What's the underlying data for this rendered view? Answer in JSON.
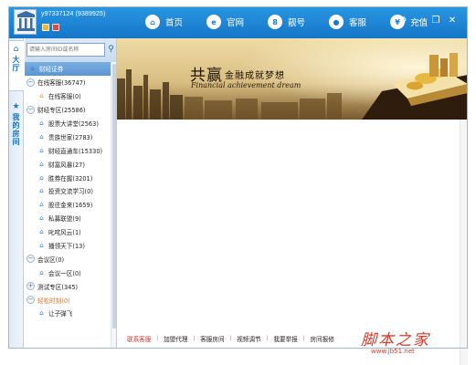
{
  "titlebar": {
    "user_id": "y97337124 (9389925)",
    "logo_icon": "building-logo",
    "accent_color": "#1b7bcc",
    "nav": [
      {
        "label": "首页",
        "icon": "home-icon",
        "glyph": "⌂"
      },
      {
        "label": "官网",
        "icon": "ie-icon",
        "glyph": "e"
      },
      {
        "label": "靓号",
        "icon": "number-icon",
        "glyph": "8"
      },
      {
        "label": "客服",
        "icon": "user-icon",
        "glyph": "●"
      },
      {
        "label": "充值",
        "icon": "yen-icon",
        "glyph": "¥"
      }
    ],
    "controls": {
      "settings": "⚙",
      "minimize": "–",
      "restore": "❐",
      "close": "✕"
    }
  },
  "vtabs": [
    {
      "label": "大厅",
      "icon": "home-icon",
      "glyph": "⌂"
    },
    {
      "label": "我的房间",
      "icon": "star-icon",
      "glyph": "★"
    }
  ],
  "search": {
    "placeholder": "请输入房间ID或名称",
    "button_glyph": "⚲"
  },
  "tree": [
    {
      "text": "财经证券",
      "level": "header",
      "glyph": "⌂"
    },
    {
      "text": "在线客服(36747)",
      "level": "group",
      "glyph": "−"
    },
    {
      "text": "在线客服(0)",
      "level": "item",
      "glyph": "⌂",
      "orange": true
    },
    {
      "text": "财经专区(25586)",
      "level": "group",
      "glyph": "−"
    },
    {
      "text": "股票大讲堂(2563)",
      "level": "item",
      "glyph": "⌂"
    },
    {
      "text": "贵族世家(2783)",
      "level": "item",
      "glyph": "⌂"
    },
    {
      "text": "财经直通车(15330)",
      "level": "item",
      "glyph": "⌂"
    },
    {
      "text": "财富风暴(27)",
      "level": "item",
      "glyph": "⌂"
    },
    {
      "text": "胜券在握(3201)",
      "level": "item",
      "glyph": "⌂"
    },
    {
      "text": "投资交流学习(0)",
      "level": "item",
      "glyph": "⌂"
    },
    {
      "text": "股往金来(1659)",
      "level": "item",
      "glyph": "⌂"
    },
    {
      "text": "私募联盟(9)",
      "level": "item",
      "glyph": "⌂"
    },
    {
      "text": "叱咤风云(1)",
      "level": "item",
      "glyph": "⌂"
    },
    {
      "text": "播领天下(13)",
      "level": "item",
      "glyph": "⌂"
    },
    {
      "text": "会议区(0)",
      "level": "group",
      "glyph": "−"
    },
    {
      "text": "会议一区(0)",
      "level": "item",
      "glyph": "⌂"
    },
    {
      "text": "测试专区(345)",
      "level": "group",
      "glyph": "+"
    },
    {
      "text": "轻松时刻(0)",
      "level": "group",
      "glyph": "−",
      "orange": true
    },
    {
      "text": "让子弹飞",
      "level": "item",
      "glyph": "⌂"
    }
  ],
  "banner": {
    "title": "共赢",
    "subtitle": "金融成就梦想",
    "english": "Financial achievement dream"
  },
  "bottom_links": [
    "联系客服",
    "加盟代理",
    "客服房间",
    "视频调节",
    "我要举报",
    "房间报修"
  ],
  "watermark": {
    "cn": "脚本之家",
    "url": "www.jb51.net"
  }
}
